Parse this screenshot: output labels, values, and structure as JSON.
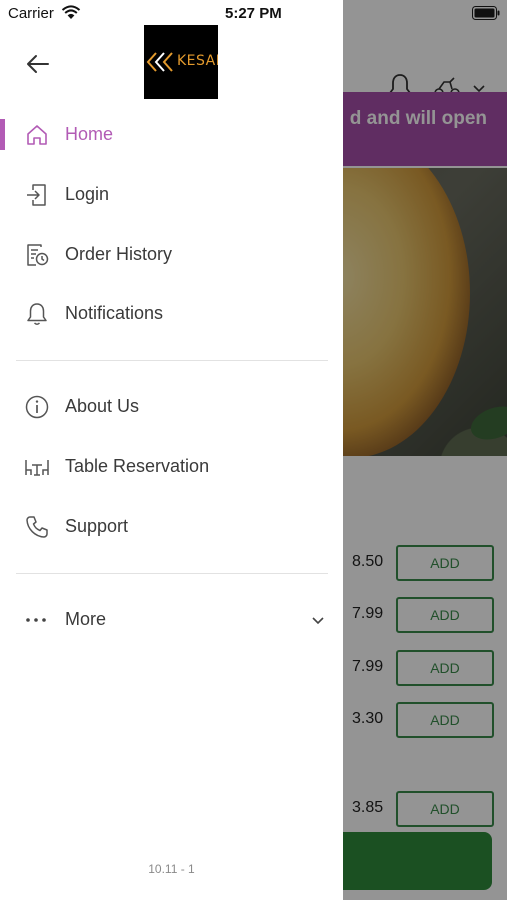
{
  "status_bar": {
    "carrier": "Carrier",
    "time": "5:27 PM"
  },
  "background": {
    "banner_text": "d and will open",
    "items": [
      {
        "price": "8.50",
        "add_label": "ADD"
      },
      {
        "price": "7.99",
        "add_label": "ADD"
      },
      {
        "price": "7.99",
        "add_label": "ADD"
      },
      {
        "price": "3.30",
        "add_label": "ADD"
      },
      {
        "price": "3.85",
        "add_label": "ADD"
      }
    ],
    "accent_color": "#a64ea9",
    "add_color": "#3a8a4a"
  },
  "drawer": {
    "logo_text": "KESAR",
    "menu_primary": [
      {
        "label": "Home",
        "icon": "home-icon",
        "active": true
      },
      {
        "label": "Login",
        "icon": "login-icon",
        "active": false
      },
      {
        "label": "Order History",
        "icon": "order-history-icon",
        "active": false
      },
      {
        "label": "Notifications",
        "icon": "bell-icon",
        "active": false
      }
    ],
    "menu_secondary": [
      {
        "label": "About Us",
        "icon": "info-icon"
      },
      {
        "label": "Table Reservation",
        "icon": "table-icon"
      },
      {
        "label": "Support",
        "icon": "phone-icon"
      }
    ],
    "more_label": "More",
    "version": "10.11 - 1",
    "active_color": "#b25bb5"
  }
}
